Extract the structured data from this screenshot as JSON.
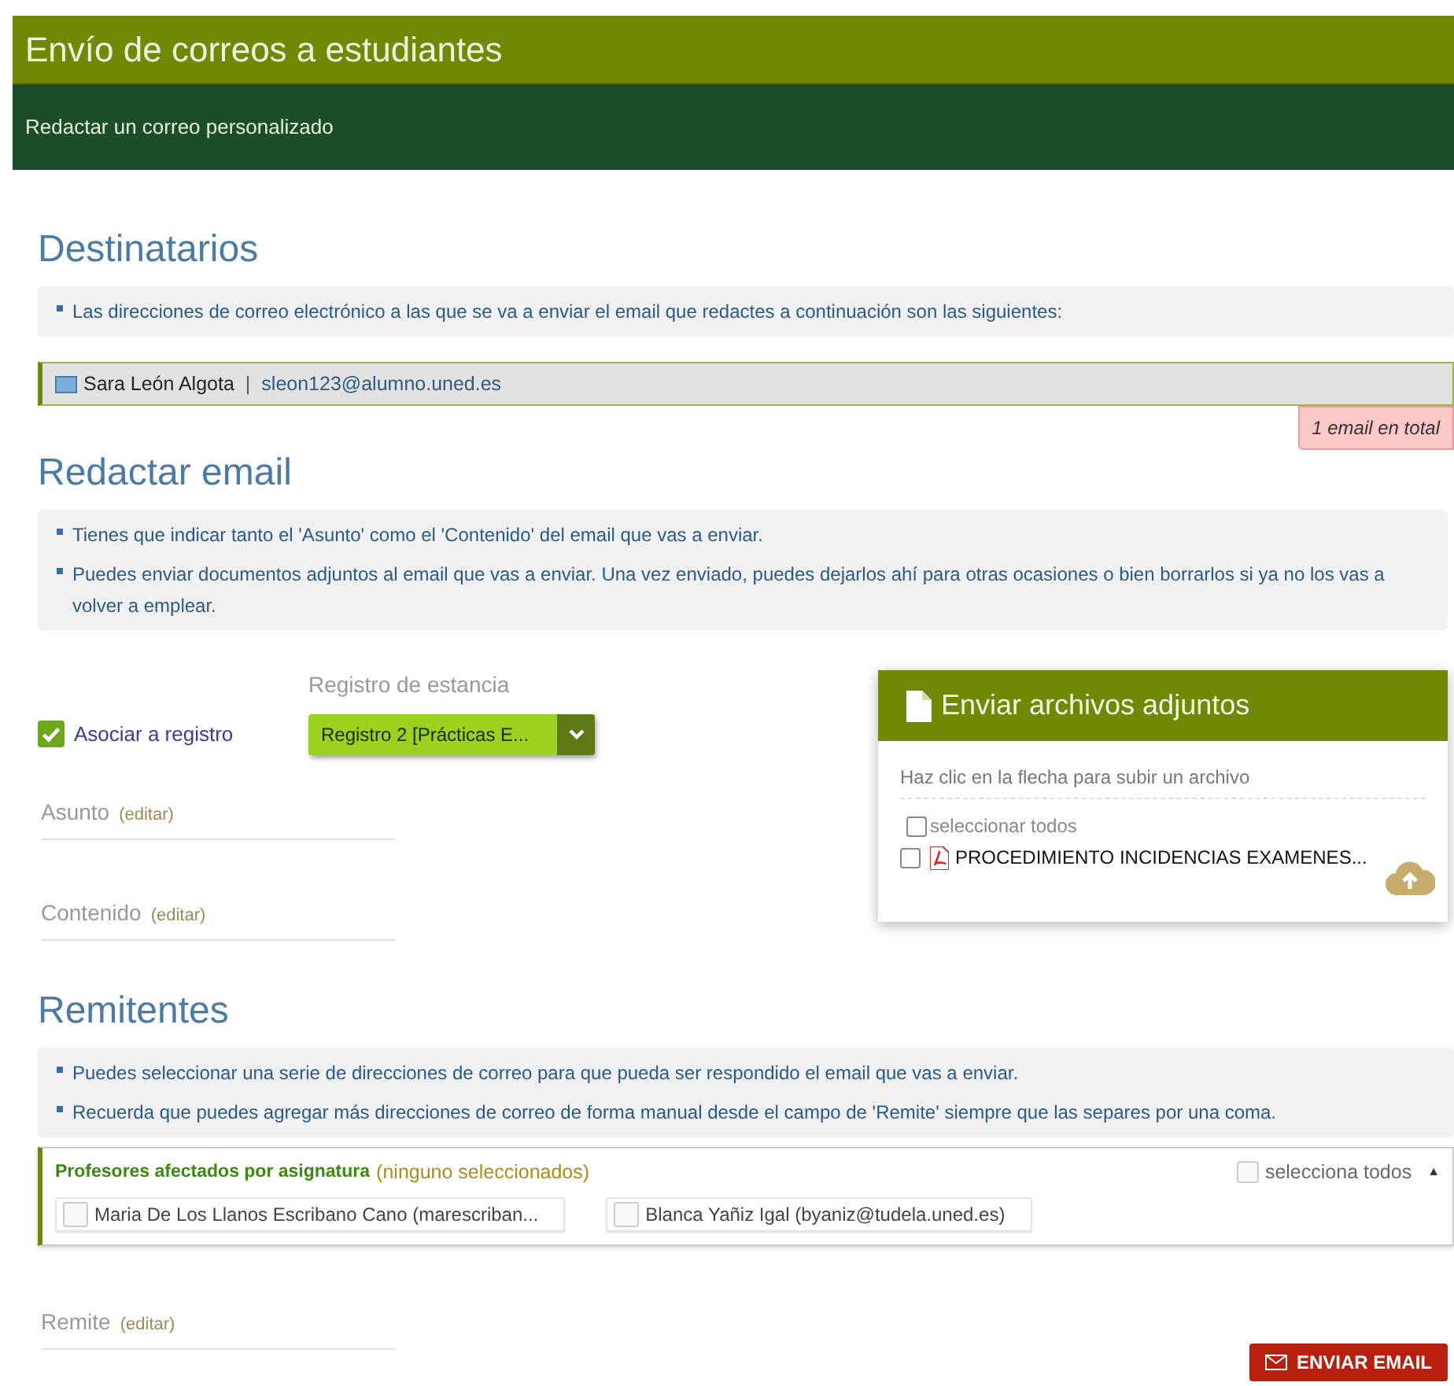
{
  "header": {
    "title": "Envío de correos a estudiantes",
    "subtitle": "Redactar un correo personalizado"
  },
  "recipients": {
    "heading": "Destinatarios",
    "notes": [
      "Las direcciones de correo electrónico a las que se va a enviar el email que redactes a continuación son las siguientes:"
    ],
    "items": [
      {
        "name": "Sara León Algota",
        "separator": "|",
        "email": "sleon123@alumno.uned.es"
      }
    ],
    "total": "1 email en total"
  },
  "compose": {
    "heading": "Redactar email",
    "notes": [
      "Tienes que indicar tanto el 'Asunto' como el 'Contenido' del email que vas a enviar.",
      "Puedes enviar documentos adjuntos al email que vas a enviar. Una vez enviado, puedes dejarlos ahí para otras ocasiones o bien borrarlos si ya no los vas a volver a emplear."
    ],
    "associate": {
      "label": "Asociar a registro",
      "checked": true
    },
    "register": {
      "label": "Registro de estancia",
      "value": "Registro 2 [Prácticas E..."
    },
    "fields": [
      {
        "label": "Asunto",
        "action": "(editar)"
      },
      {
        "label": "Contenido",
        "action": "(editar)"
      }
    ]
  },
  "attachments": {
    "title": "Enviar archivos adjuntos",
    "hint": "Haz clic en la flecha para subir un archivo",
    "select_all": {
      "label": "seleccionar todos",
      "checked": false
    },
    "files": [
      {
        "name": "PROCEDIMIENTO INCIDENCIAS EXAMENES...",
        "checked": false
      }
    ]
  },
  "senders": {
    "heading": "Remitentes",
    "notes": [
      "Puedes seleccionar una serie de direcciones de correo para que pueda ser respondido el email que vas a enviar.",
      "Recuerda que puedes agregar más direcciones de correo de forma manual desde el campo de 'Remite' siempre que las separes por una coma."
    ],
    "group": {
      "title": "Profesores afectados por asignatura",
      "status": "(ninguno seleccionados)",
      "select_all": {
        "label": "selecciona todos",
        "checked": false
      },
      "toggle": "▲",
      "people": [
        {
          "label": "Maria De Los Llanos Escribano Cano (marescriban...",
          "checked": false
        },
        {
          "label": "Blanca Yañiz Igal (byaniz@tudela.uned.es)",
          "checked": false
        }
      ]
    },
    "field": {
      "label": "Remite",
      "action": "(editar)"
    }
  },
  "send_button": "ENVIAR EMAIL"
}
